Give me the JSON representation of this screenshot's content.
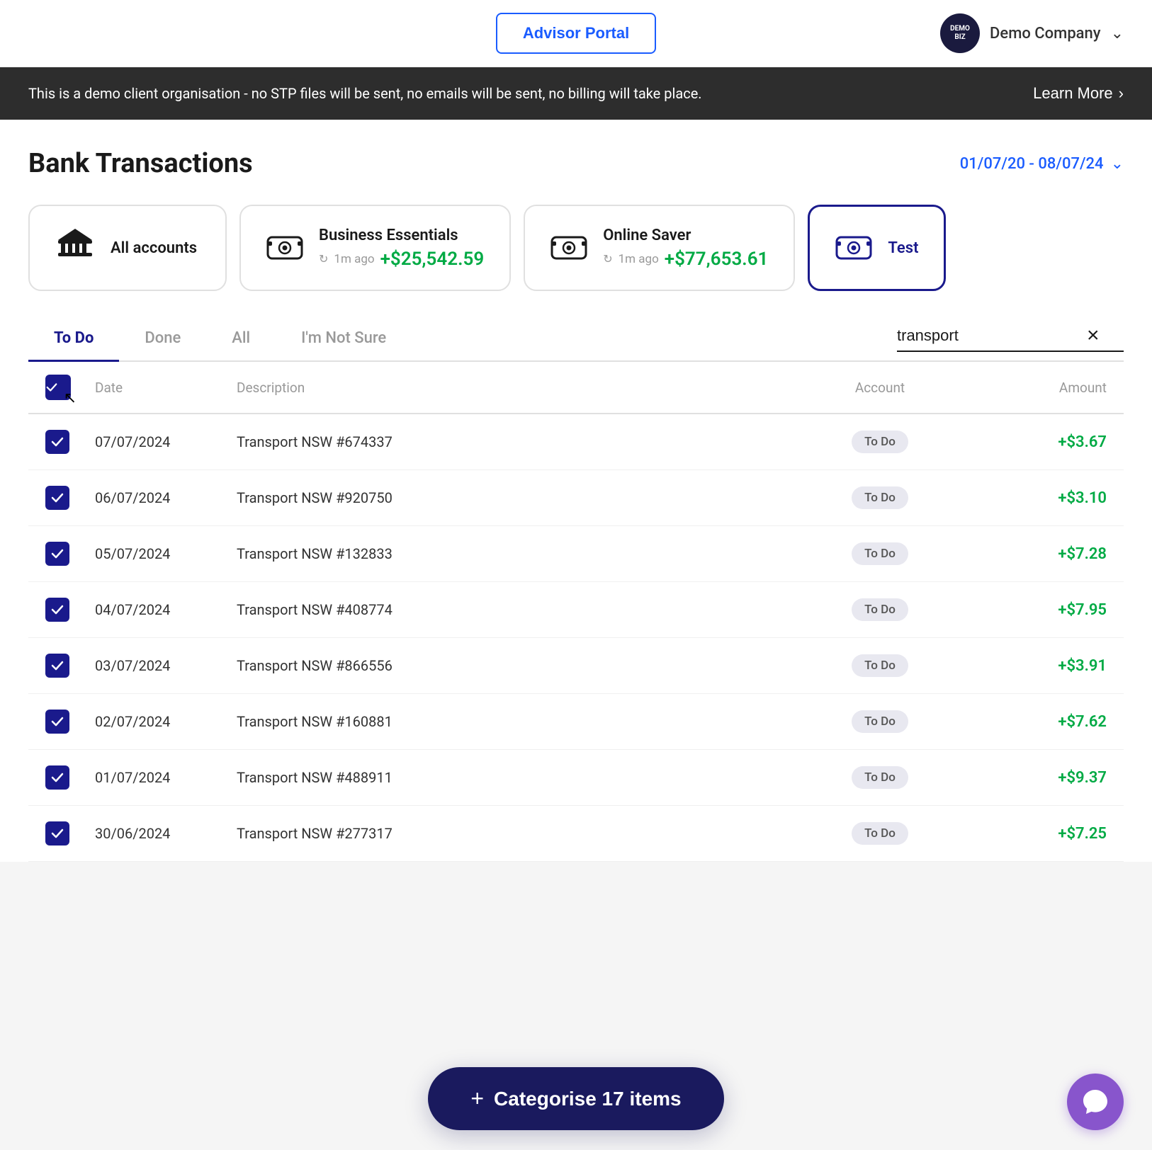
{
  "topNav": {
    "advisorPortalLabel": "Advisor Portal",
    "companyName": "Demo Company",
    "companyAvatarText": "DEMO\nBIZ"
  },
  "demoBanner": {
    "text": "This is a demo client organisation - no STP files will be sent, no emails will be sent, no billing will take place.",
    "learnMoreLabel": "Learn More"
  },
  "pageHeader": {
    "title": "Bank Transactions",
    "dateRange": "01/07/20 - 08/07/24"
  },
  "accountCards": [
    {
      "id": "all",
      "name": "All accounts",
      "type": "bank",
      "selected": false
    },
    {
      "id": "business",
      "name": "Business Essentials",
      "type": "account",
      "time": "1m ago",
      "balance": "+$25,542.59",
      "selected": false
    },
    {
      "id": "online",
      "name": "Online Saver",
      "type": "account",
      "time": "1m ago",
      "balance": "+$77,653.61",
      "selected": false
    },
    {
      "id": "test",
      "name": "Test",
      "type": "account",
      "selected": true
    }
  ],
  "tabs": [
    {
      "id": "todo",
      "label": "To Do",
      "active": true
    },
    {
      "id": "done",
      "label": "Done",
      "active": false
    },
    {
      "id": "all",
      "label": "All",
      "active": false
    },
    {
      "id": "notsure",
      "label": "I'm Not Sure",
      "active": false
    }
  ],
  "searchValue": "transport",
  "tableHeaders": {
    "date": "Date",
    "description": "Description",
    "account": "Account",
    "amount": "Amount"
  },
  "rows": [
    {
      "date": "07/07/2024",
      "description": "Transport NSW #674337",
      "status": "To Do",
      "amount": "+$3.67"
    },
    {
      "date": "06/07/2024",
      "description": "Transport NSW #920750",
      "status": "To Do",
      "amount": "+$3.10"
    },
    {
      "date": "05/07/2024",
      "description": "Transport NSW #132833",
      "status": "To Do",
      "amount": "+$7.28"
    },
    {
      "date": "04/07/2024",
      "description": "Transport NSW #408774",
      "status": "To Do",
      "amount": "+$7.95"
    },
    {
      "date": "03/07/2024",
      "description": "Transport NSW #866556",
      "status": "To Do",
      "amount": "+$3.91"
    },
    {
      "date": "02/07/2024",
      "description": "Transport NSW #160881",
      "status": "To Do",
      "amount": "+$7.62"
    },
    {
      "date": "01/07/2024",
      "description": "Transport NSW #488911",
      "status": "To Do",
      "amount": "+$9.37"
    },
    {
      "date": "30/06/2024",
      "description": "Transport NSW #277317",
      "status": "To Do",
      "amount": "+$7.25"
    }
  ],
  "categoriseBtn": {
    "label": "Categorise 17 items",
    "plus": "+"
  },
  "chatBtn": {
    "label": "Chat"
  }
}
